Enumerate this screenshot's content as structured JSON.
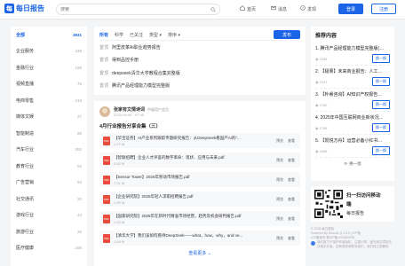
{
  "header": {
    "logo_char": "每",
    "logo_text": "每日报告",
    "search_placeholder": "搜索",
    "nav": [
      {
        "label": "首页",
        "icon": "home-icon"
      },
      {
        "label": "消息",
        "icon": "message-icon"
      },
      {
        "label": "发现",
        "icon": "compass-icon"
      }
    ],
    "login_label": "登录",
    "register_label": "注册"
  },
  "sidebar": {
    "items": [
      {
        "label": "全部",
        "count": "3931",
        "active": true
      },
      {
        "label": "企业服务",
        "count": "239"
      },
      {
        "label": "金融行业",
        "count": "199"
      },
      {
        "label": "视频直播",
        "count": "76"
      },
      {
        "label": "电商零售",
        "count": "218"
      },
      {
        "label": "媒体文娱",
        "count": "27"
      },
      {
        "label": "智能制造",
        "count": "96"
      },
      {
        "label": "汽车行业",
        "count": "253"
      },
      {
        "label": "教育行业",
        "count": "92"
      },
      {
        "label": "广告营销",
        "count": "93"
      },
      {
        "label": "社交通讯",
        "count": "20"
      },
      {
        "label": "游戏行业",
        "count": "42"
      },
      {
        "label": "旅游行业",
        "count": "26"
      },
      {
        "label": "医疗健康",
        "count": "189"
      }
    ]
  },
  "feed": {
    "tabs": [
      {
        "label": "所有",
        "active": true
      },
      {
        "label": "科学"
      },
      {
        "label": "已关注"
      },
      {
        "label": "类型 ▾"
      },
      {
        "label": "排序 ▾"
      }
    ],
    "publish_label": "发布",
    "qa": [
      {
        "tag": "置顶",
        "title": "阿里皮革AI职业趋势报告"
      },
      {
        "tag": "置顶",
        "title": "得到品控手册"
      },
      {
        "tag": "置顶",
        "title": "deepseek清华大学教程合集完整版"
      },
      {
        "tag": "置顶",
        "title": "腾讯产品经理能力模型完整版"
      }
    ],
    "post": {
      "author": "张家有文情诗词",
      "role": "中级用户会员",
      "date": "2025-04-04 · 07:45",
      "title": "4月行业报告分享合集（三）",
      "files": [
        {
          "name": "【华宝证券】AI产业系列跟踪专题研究报告：从DeepSeek看国产AI的“...",
          "size": "1.27 M"
        },
        {
          "name": "【智联招聘】企业人才评鉴的数字革命：现状、应用与未来.pdf",
          "size": "2.62 M"
        },
        {
          "name": "【Sensor Tower】2025年移动市场报告.pdf",
          "size": "7.21 M"
        },
        {
          "name": "【企业研究院】2025年轻人求职招聘报告.pdf",
          "size": "1.39 M"
        },
        {
          "name": "【国家研究院】2025年在新时代精准市场经营，趋势及机会研判报告.pdf",
          "size": "1.02 M"
        },
        {
          "name": "【清华大学】我们该如何看待DeepSeek——what，how，why，and ne...",
          "size": "1.49 M"
        }
      ],
      "action_preview": "预览",
      "action_view": "查看",
      "more_label": "查看更多 ⌄"
    }
  },
  "recommend": {
    "title": "推荐内容",
    "items": [
      {
        "name": "1. 腾讯产品经理能力模型完整版(…",
        "views": "2183"
      },
      {
        "name": "2. 【极果】未来商业报告：人工…",
        "views": "1931"
      },
      {
        "name": "3. 【朴睿咨询】AI知识产权报告…",
        "views": "1760"
      },
      {
        "name": "4. 2025年中国互联网商业新状况…",
        "views": "1706"
      },
      {
        "name": "5. 【凯悦方舟】运营必备小红书…",
        "views": "1606"
      }
    ],
    "item_button": "换一换",
    "refresh_label": "换一批"
  },
  "app": {
    "line1": "扫一扫访问移动",
    "line2": "端",
    "line3": "每日报告"
  },
  "footer": {
    "line1": "© 2025 每日报告",
    "line2": "Powered By Discuz! Q 2.0.0 | ICP备",
    "line3": "ICP备案号 蜀ICP备10038003号",
    "note": "我们致力于保护作者版权，注重分享，被刊用文章因无法核实作者，如有侵权请联系我们，我们将立即删除"
  },
  "colors": {
    "accent": "#1b64e8",
    "background": "#f4f5f7"
  }
}
